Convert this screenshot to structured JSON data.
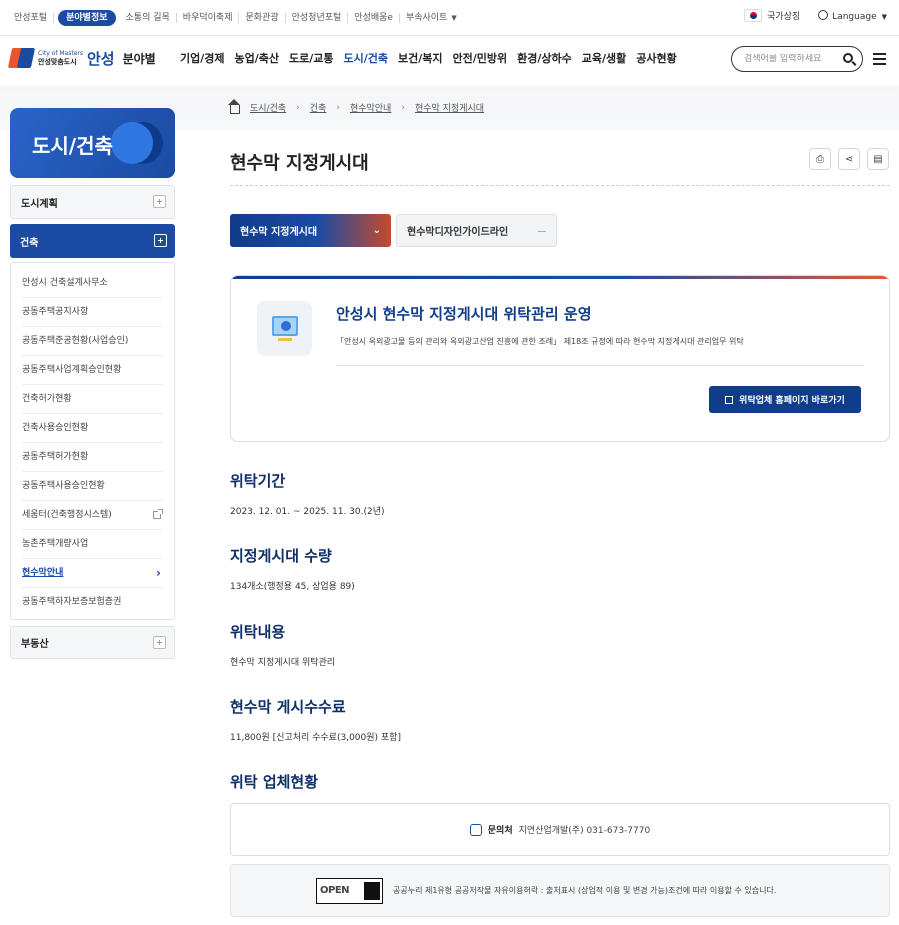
{
  "topbar": {
    "links": [
      "안성포털",
      "분야별정보",
      "소통의 길목",
      "바우덕이축제",
      "문화관광",
      "안성청년포털",
      "안성배움e",
      "부속사이트"
    ],
    "active_link": "분야별정보",
    "national_symbol": "국가상징",
    "language": "Language"
  },
  "header": {
    "logo_small_1": "City of Masters",
    "logo_small_2": "안성맞춤도시",
    "logo_name": "안성",
    "logo_sub": "분야별",
    "menu": [
      "기업/경제",
      "농업/축산",
      "도로/교통",
      "도시/건축",
      "보건/복지",
      "안전/민방위",
      "환경/상하수",
      "교육/생활",
      "공사현황"
    ],
    "active_menu": "도시/건축",
    "search_placeholder": "검색어를 입력하세요"
  },
  "breadcrumb": [
    "도시/건축",
    "건축",
    "현수막안내",
    "현수막 지정게시대"
  ],
  "sidebar": {
    "title": "도시/건축",
    "groups": {
      "g1": "도시계획",
      "g2": "건축",
      "g3": "부동산"
    },
    "items": [
      "안성시 건축설계사무소",
      "공동주택공지사항",
      "공동주택준공현황(사업승인)",
      "공동주택사업계획승인현황",
      "건축허가현황",
      "건축사용승인현황",
      "공동주택허가현황",
      "공동주택사용승인현황",
      "세움터(건축행정시스템)",
      "농촌주택개량사업",
      "현수막안내",
      "공동주택하자보증보험증권"
    ],
    "current_item": "현수막안내"
  },
  "main": {
    "title": "현수막 지정게시대",
    "tools": [
      "print-icon",
      "share-icon",
      "printer-icon"
    ],
    "tabs": [
      "현수막 지정게시대",
      "현수막디자인가이드라인"
    ],
    "card": {
      "heading": "안성시 현수막 지정게시대 위탁관리 운영",
      "text": "「안성시 옥외광고물 등의 관리와 옥외광고산업 진흥에 관한 조례」 제18조 규정에 따라 현수막 지정게시대 관리업무 위탁",
      "button": "위탁업체 홈페이지 바로가기"
    },
    "sections": [
      {
        "heading": "위탁기간",
        "text": "2023. 12. 01. ~ 2025. 11. 30.(2년)"
      },
      {
        "heading": "지정게시대 수량",
        "text": "134개소(행정용 45, 상업용 89)"
      },
      {
        "heading": "위탁내용",
        "text": "현수막 지정게시대 위탁관리"
      },
      {
        "heading": "현수막 게시수수료",
        "text": "11,800원 [신고처리 수수료(3,000원) 포함]"
      },
      {
        "heading": "위탁 업체현황",
        "text": ""
      }
    ],
    "contact": {
      "label": "문의처",
      "value": "지연산업개발(주) 031-673-7770"
    },
    "license": {
      "badge": "OPEN",
      "text": "공공누리 제1유형 공공저작물 자유이용허락 : 출처표시 (상업적 이용 및 변경 가능)조건에 따라 이용할 수 있습니다."
    }
  }
}
